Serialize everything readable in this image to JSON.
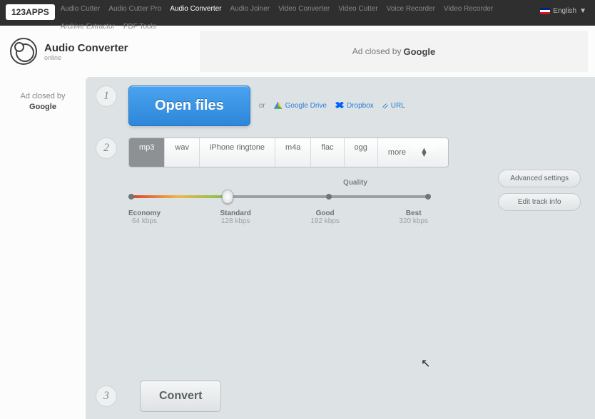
{
  "nav": {
    "logo": "123APPS",
    "items": [
      "Audio Cutter",
      "Audio Cutter Pro",
      "Audio Converter",
      "Audio Joiner",
      "Video Converter",
      "Video Cutter",
      "Voice Recorder",
      "Video Recorder",
      "Archive Extractor",
      "PDF Tools"
    ],
    "active_index": 2,
    "language": "English"
  },
  "brand": {
    "title": "Audio Converter",
    "subtitle": "online"
  },
  "ads": {
    "closed_prefix": "Ad closed by ",
    "google": "Google"
  },
  "step1": {
    "open": "Open files",
    "or": "or",
    "gdrive": "Google Drive",
    "dropbox": "Dropbox",
    "url": "URL"
  },
  "formats": [
    "mp3",
    "wav",
    "iPhone ringtone",
    "m4a",
    "flac",
    "ogg",
    "more"
  ],
  "formats_selected": 0,
  "quality": {
    "title": "Quality",
    "ticks": [
      {
        "label": "Economy",
        "bitrate": "64 kbps"
      },
      {
        "label": "Standard",
        "bitrate": "128 kbps"
      },
      {
        "label": "Good",
        "bitrate": "192 kbps"
      },
      {
        "label": "Best",
        "bitrate": "320 kbps"
      }
    ]
  },
  "side": {
    "advanced": "Advanced settings",
    "editinfo": "Edit track info"
  },
  "convert": "Convert"
}
